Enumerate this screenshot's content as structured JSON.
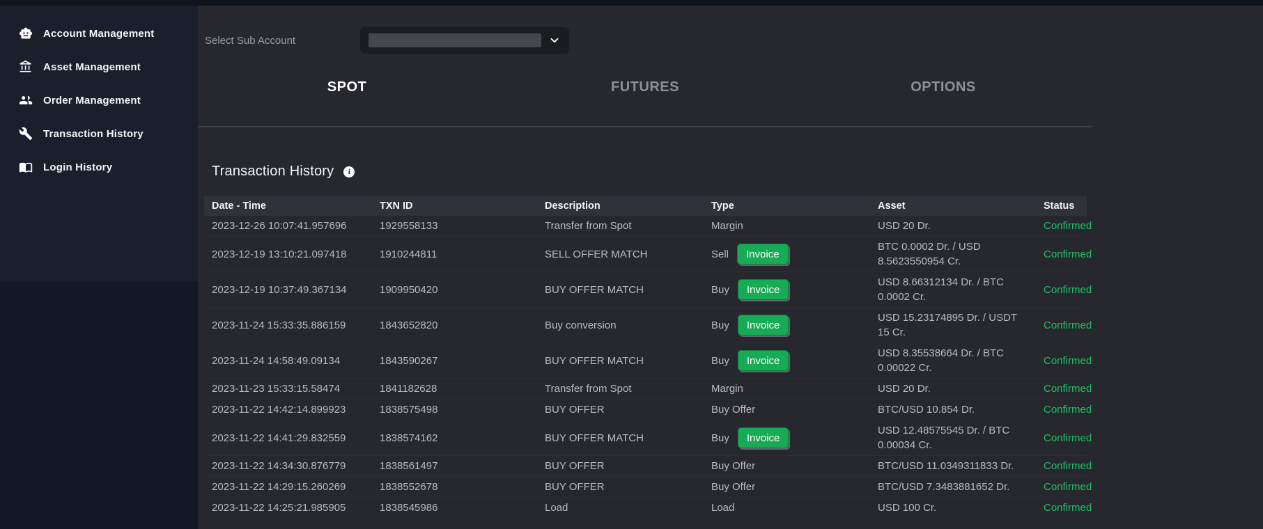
{
  "colors": {
    "sidebar_bg": "#141824",
    "sidebar_card_bg": "#1a1f2b",
    "main_bg": "#27282d",
    "header_band_bg": "#30323a",
    "invoice_green": "#17ab55",
    "status_green": "#1fc065",
    "text_muted": "#b9bbc2"
  },
  "sidebar": {
    "items": [
      {
        "label": "Account Management",
        "icon": "robot-icon"
      },
      {
        "label": "Asset Management",
        "icon": "bank-icon"
      },
      {
        "label": "Order Management",
        "icon": "people-icon"
      },
      {
        "label": "Transaction History",
        "icon": "wrench-icon"
      },
      {
        "label": "Login History",
        "icon": "book-icon"
      }
    ]
  },
  "subaccount": {
    "label": "Select Sub Account"
  },
  "tabs": [
    {
      "label": "SPOT",
      "active": true
    },
    {
      "label": "FUTURES",
      "active": false
    },
    {
      "label": "OPTIONS",
      "active": false
    }
  ],
  "section": {
    "title": "Transaction History",
    "info_icon_glyph": "i"
  },
  "table": {
    "invoice_label": "Invoice",
    "headers": [
      "Date - Time",
      "TXN ID",
      "Description",
      "Type",
      "Asset",
      "Status"
    ],
    "rows": [
      {
        "datetime": "2023-12-26 10:07:41.957696",
        "txn_id": "1929558133",
        "description": "Transfer from Spot",
        "type": "Margin",
        "invoice": false,
        "asset": "USD 20 Dr.",
        "status": "Confirmed"
      },
      {
        "datetime": "2023-12-19 13:10:21.097418",
        "txn_id": "1910244811",
        "description": "SELL OFFER MATCH",
        "type": "Sell",
        "invoice": true,
        "asset": "BTC 0.0002 Dr. / USD 8.5623550954 Cr.",
        "status": "Confirmed"
      },
      {
        "datetime": "2023-12-19 10:37:49.367134",
        "txn_id": "1909950420",
        "description": "BUY OFFER MATCH",
        "type": "Buy",
        "invoice": true,
        "asset": "USD 8.66312134 Dr. / BTC 0.0002 Cr.",
        "status": "Confirmed"
      },
      {
        "datetime": "2023-11-24 15:33:35.886159",
        "txn_id": "1843652820",
        "description": "Buy conversion",
        "type": "Buy",
        "invoice": true,
        "asset": "USD 15.23174895 Dr. / USDT 15 Cr.",
        "status": "Confirmed"
      },
      {
        "datetime": "2023-11-24 14:58:49.09134",
        "txn_id": "1843590267",
        "description": "BUY OFFER MATCH",
        "type": "Buy",
        "invoice": true,
        "asset": "USD 8.35538664 Dr. / BTC 0.00022 Cr.",
        "status": "Confirmed"
      },
      {
        "datetime": "2023-11-23 15:33:15.58474",
        "txn_id": "1841182628",
        "description": "Transfer from Spot",
        "type": "Margin",
        "invoice": false,
        "asset": "USD 20 Dr.",
        "status": "Confirmed"
      },
      {
        "datetime": "2023-11-22 14:42:14.899923",
        "txn_id": "1838575498",
        "description": "BUY OFFER",
        "type": "Buy Offer",
        "invoice": false,
        "asset": "BTC/USD 10.854 Dr.",
        "status": "Confirmed"
      },
      {
        "datetime": "2023-11-22 14:41:29.832559",
        "txn_id": "1838574162",
        "description": "BUY OFFER MATCH",
        "type": "Buy",
        "invoice": true,
        "asset": "USD 12.48575545 Dr. / BTC 0.00034 Cr.",
        "status": "Confirmed"
      },
      {
        "datetime": "2023-11-22 14:34:30.876779",
        "txn_id": "1838561497",
        "description": "BUY OFFER",
        "type": "Buy Offer",
        "invoice": false,
        "asset": "BTC/USD 11.0349311833 Dr.",
        "status": "Confirmed"
      },
      {
        "datetime": "2023-11-22 14:29:15.260269",
        "txn_id": "1838552678",
        "description": "BUY OFFER",
        "type": "Buy Offer",
        "invoice": false,
        "asset": "BTC/USD 7.3483881652 Dr.",
        "status": "Confirmed"
      },
      {
        "datetime": "2023-11-22 14:25:21.985905",
        "txn_id": "1838545986",
        "description": "Load",
        "type": "Load",
        "invoice": false,
        "asset": "USD 100 Cr.",
        "status": "Confirmed"
      }
    ]
  }
}
